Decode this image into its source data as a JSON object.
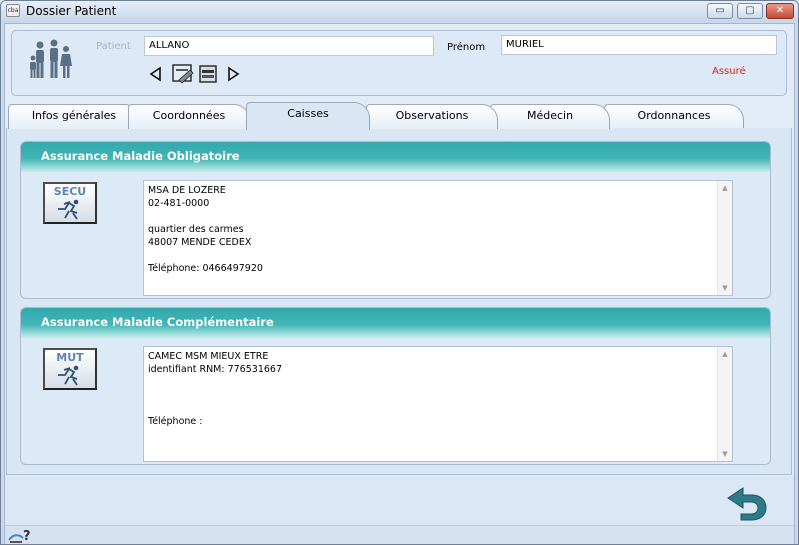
{
  "window": {
    "title": "Dossier Patient",
    "app_icon": "cba",
    "controls": {
      "minimize": "▭",
      "maximize": "▢",
      "close": "✕"
    }
  },
  "patient": {
    "label_patient": "Patient",
    "nom": "ALLANO",
    "label_prenom": "Prénom",
    "prenom": "MURIEL",
    "status": "Assuré"
  },
  "icons": {
    "family": "family-icon",
    "prev": "triangle-left-icon",
    "edit": "edit-card-icon",
    "card": "card-reader-icon",
    "next": "triangle-right-icon",
    "back": "return-arrow-icon",
    "help": "help-icon"
  },
  "tabs": [
    {
      "label": "Infos générales"
    },
    {
      "label": "Coordonnées"
    },
    {
      "label": "Caisses",
      "active": true
    },
    {
      "label": "Observations"
    },
    {
      "label": "Médecin"
    },
    {
      "label": "Ordonnances"
    }
  ],
  "amo": {
    "title": "Assurance Maladie Obligatoire",
    "card_label": "SECU",
    "lines": "MSA DE LOZERE\n02-481-0000\n\nquartier des carmes\n48007 MENDE CEDEX\n\nTéléphone: 0466497920"
  },
  "amc": {
    "title": "Assurance Maladie Complémentaire",
    "card_label": "MUT",
    "lines": "CAMEC MSM MIEUX ETRE\nidentifiant RNM: 776531667\n\n\n\nTéléphone :"
  },
  "colors": {
    "accent_header": "#3bb0b3",
    "assure_red": "#d2221c",
    "return_arrow": "#2f7a8a"
  }
}
